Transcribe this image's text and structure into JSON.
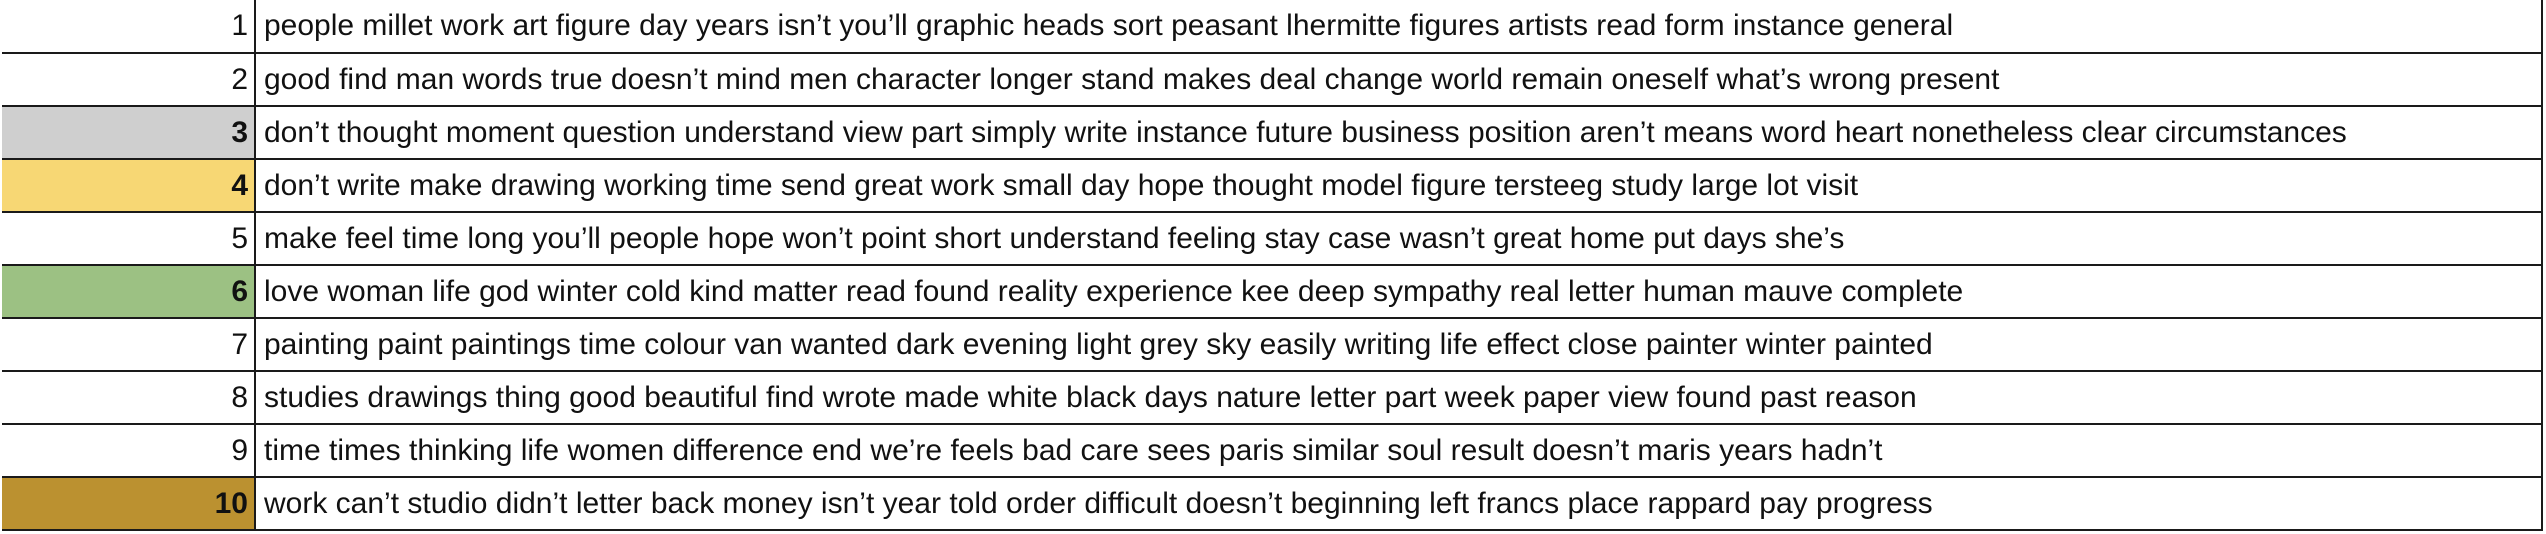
{
  "rows": [
    {
      "num": "1",
      "words": "people millet work art figure day years isn’t you’ll graphic heads sort peasant lhermitte figures artists read form instance general",
      "color": "#ffffff",
      "bold": false
    },
    {
      "num": "2",
      "words": "good find man words true doesn’t mind men character longer stand makes deal change world remain oneself what’s wrong present",
      "color": "#ffffff",
      "bold": false
    },
    {
      "num": "3",
      "words": "don’t thought moment question understand view part simply write instance future business position aren’t means word heart nonetheless clear circumstances",
      "color": "#cfcfcf",
      "bold": true
    },
    {
      "num": "4",
      "words": "don’t write make drawing working time send great work small day hope thought model figure tersteeg study large lot visit",
      "color": "#f7d774",
      "bold": true
    },
    {
      "num": "5",
      "words": "make feel time long you’ll people hope won’t point short understand feeling stay case wasn’t great home put days she’s",
      "color": "#ffffff",
      "bold": false
    },
    {
      "num": "6",
      "words": "love woman life god winter cold kind matter read found reality experience kee deep sympathy real letter human mauve complete",
      "color": "#9cc183",
      "bold": true
    },
    {
      "num": "7",
      "words": "painting paint paintings time colour van wanted dark evening light grey sky easily writing life effect close painter winter painted",
      "color": "#ffffff",
      "bold": false
    },
    {
      "num": "8",
      "words": "studies drawings thing good beautiful find wrote made white black days nature letter part week paper view found past reason",
      "color": "#ffffff",
      "bold": false
    },
    {
      "num": "9",
      "words": "time times thinking life women difference end we’re feels bad care sees paris similar soul result doesn’t maris years hadn’t",
      "color": "#ffffff",
      "bold": false
    },
    {
      "num": "10",
      "words": "work can’t studio didn’t letter back money isn’t year told order difficult doesn’t beginning left francs place rappard pay progress",
      "color": "#bb9130",
      "bold": true
    }
  ]
}
